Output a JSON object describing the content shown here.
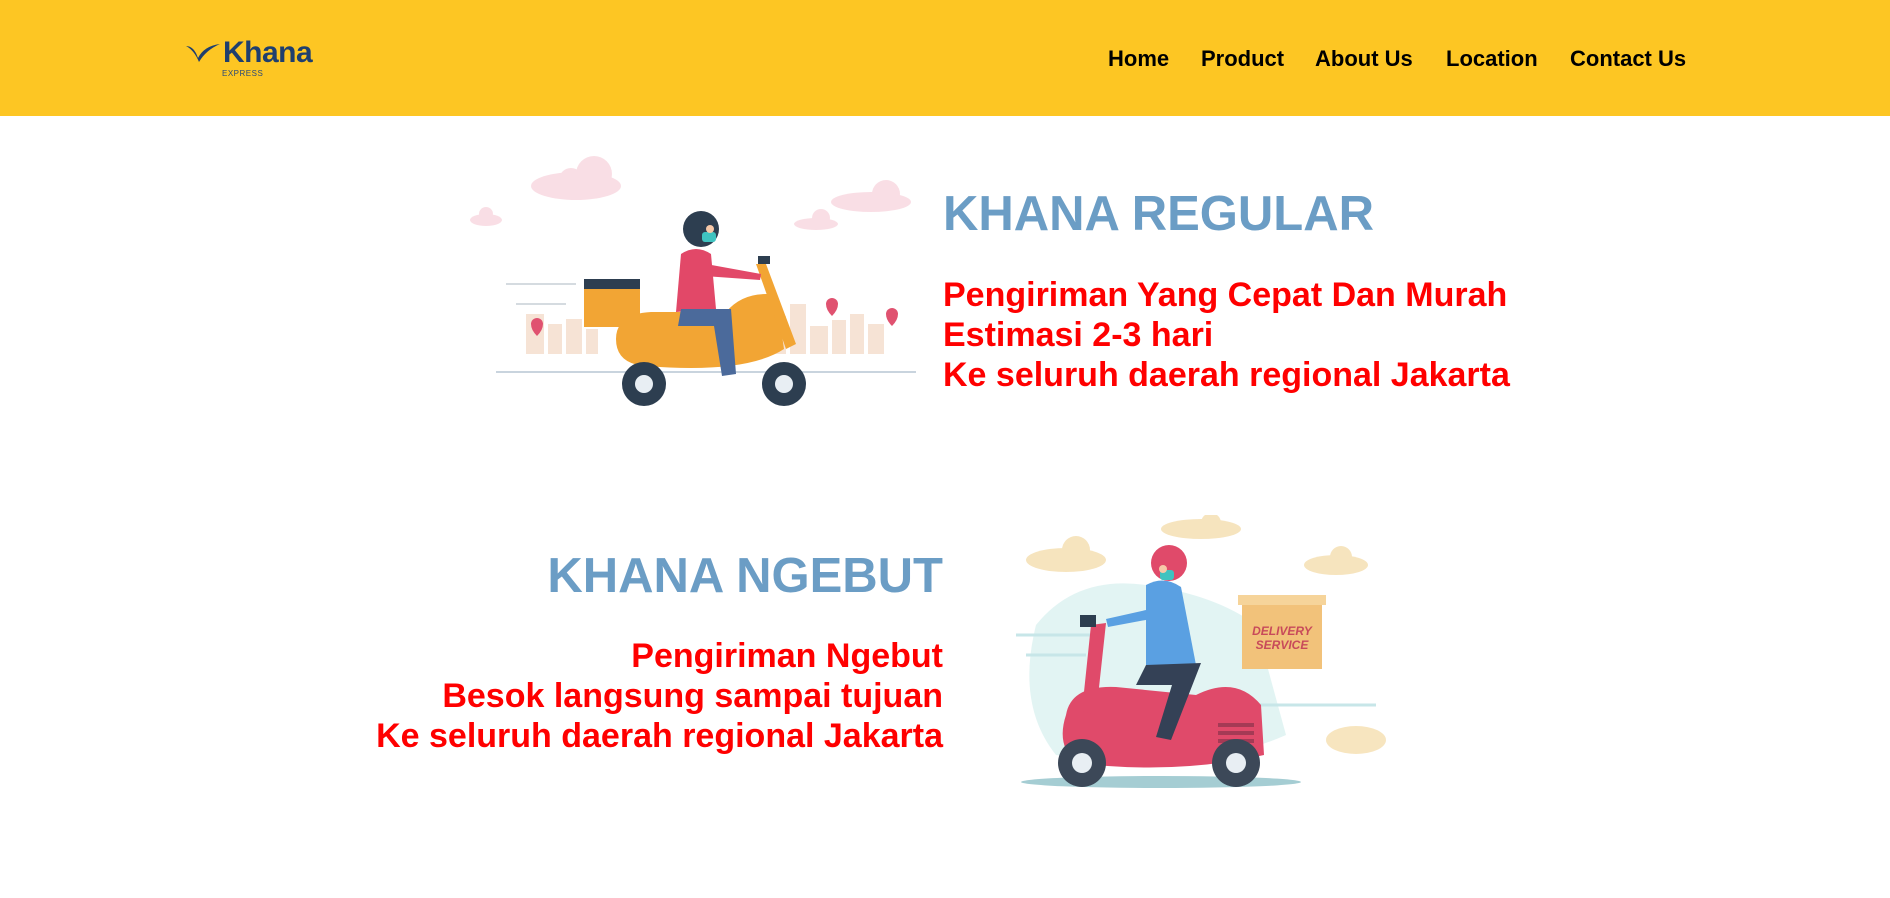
{
  "header": {
    "logo": {
      "name": "Khana",
      "subtitle": "EXPRESS"
    },
    "nav": [
      "Home",
      "Product",
      "About Us",
      "Location",
      "Contact Us"
    ],
    "colors": {
      "background": "#fdc623",
      "text": "#000000",
      "logo": "#1f3f6e"
    }
  },
  "sections": [
    {
      "title": "KHANA REGULAR",
      "lines": [
        "Pengiriman Yang Cepat Dan Murah",
        "Estimasi 2-3 hari",
        "Ke seluruh daerah regional Jakarta"
      ],
      "image": "scooter-courier-orange-illustration"
    },
    {
      "title": "KHANA NGEBUT",
      "lines": [
        "Pengiriman Ngebut",
        "Besok langsung sampai tujuan",
        "Ke seluruh daerah regional Jakarta"
      ],
      "image": "scooter-courier-red-delivery-service-illustration",
      "box_label": [
        "DELIVERY",
        "SERVICE"
      ]
    }
  ],
  "colors": {
    "title": "#6b9dc5",
    "body": "#ff0000"
  }
}
